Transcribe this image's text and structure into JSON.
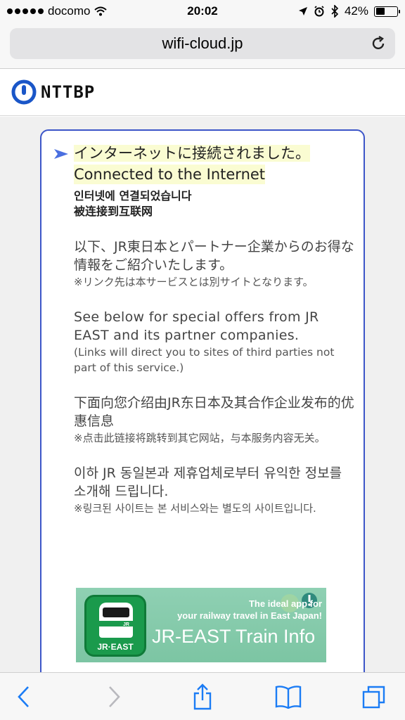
{
  "status_bar": {
    "carrier": "docomo",
    "time": "20:02",
    "battery_percent": "42%",
    "battery_level": 0.42
  },
  "address_bar": {
    "url": "wifi-cloud.jp"
  },
  "site": {
    "logo_text": "NTTBP"
  },
  "content": {
    "heading_ja": "インターネットに接続されました。",
    "heading_en": "Connected to the Internet",
    "heading_ko": "인터넷에 연결되었습니다",
    "heading_zh": "被连接到互联网",
    "ja_text": "以下、JR東日本とパートナー企業からのお得な情報をご紹介いたします。",
    "ja_note": "※リンク先は本サービスとは別サイトとなります。",
    "en_text": "See below for special offers from JR EAST and its partner companies.",
    "en_note": "(Links will direct you to sites of third parties not part of this service.)",
    "zh_text": "下面向您介绍由JR东日本及其合作企业发布的优惠信息",
    "zh_note": "※点击此链接将跳转到其它网站，与本服务内容无关。",
    "ko_text": "이하 JR 동일본과 제휴업체로부터 유익한 정보를 소개해 드립니다.",
    "ko_note": "※링크된 사이트는 본 서비스와는 별도의 사이트입니다."
  },
  "banner": {
    "icon_label": "JR·EAST",
    "tagline_1": "The ideal app for",
    "tagline_2": "your railway travel in East Japan!",
    "title": "JR-EAST Train Info"
  },
  "colors": {
    "accent": "#3c55c8",
    "highlight": "#fafcd2",
    "banner": "#86cbab",
    "jr_green": "#1a9a4c",
    "ios_blue": "#1b7cf5"
  }
}
